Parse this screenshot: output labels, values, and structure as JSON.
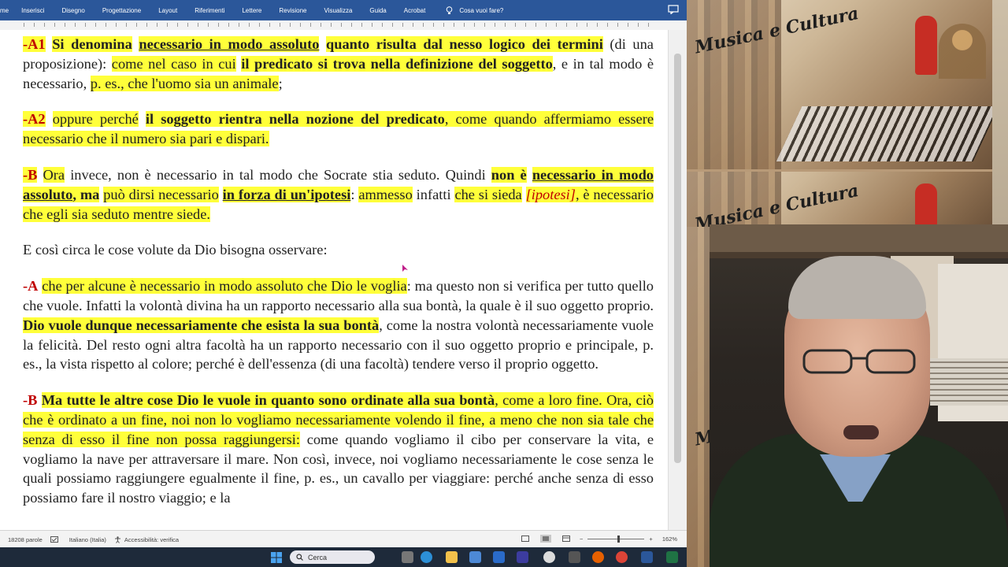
{
  "ribbon": {
    "tabs": [
      "me",
      "Inserisci",
      "Disegno",
      "Progettazione",
      "Layout",
      "Riferimenti",
      "Lettere",
      "Revisione",
      "Visualizza",
      "Guida",
      "Acrobat"
    ],
    "tell_me": "Cosa vuoi fare?"
  },
  "document": {
    "a1": {
      "label": "-A1",
      "t1": "Si denomina",
      "t2": "necessario in modo assoluto",
      "t3": "quanto risulta dal nesso logico dei termini",
      "t4": "(di una proposizione):",
      "t5": "come nel caso in cui",
      "t6": "il predicato si trova nella definizione del soggetto",
      "t7": ", e in tal modo è necessario,",
      "t8": "p. es., che l'uomo sia un animale",
      "t9": ";"
    },
    "a2": {
      "label": "-A2",
      "t1": "oppure perché",
      "t2": "il soggetto rientra nella nozione del predicato",
      "t3": ", come quando affermiamo essere necessario che il numero sia pari e dispari."
    },
    "b1": {
      "label": "-B",
      "t1": "Ora",
      "t2": "invece, non è necessario in tal modo che Socrate stia seduto. Quindi",
      "t3": "non è",
      "t4": "necessario in modo assoluto",
      "t5": ", ma",
      "t6": "può dirsi necessario",
      "t7": "in forza di un'ipotesi",
      "t8": ":",
      "t9": "ammesso",
      "t10": "infatti",
      "t11": "che si sieda",
      "t12": "[ipotesi]",
      "t13": ", è necessario che egli sia seduto mentre siede."
    },
    "p_intro": "E così circa le cose volute da Dio bisogna osservare:",
    "a3": {
      "label": "-A",
      "t1": "che per alcune è necessario in modo assoluto che Dio le voglia",
      "t2": ": ma questo non si verifica per tutto quello che vuole. Infatti la volontà divina ha un rapporto necessario alla sua bontà, la quale è il suo oggetto proprio.",
      "t3": "Dio vuole dunque necessariamente che esista la sua bontà",
      "t4": ", come la nostra volontà necessariamente vuole la felicità. Del resto ogni altra facoltà ha un rapporto necessario con il suo oggetto proprio e principale, p. es., la vista rispetto al colore; perché è dell'essenza (di una facoltà) tendere verso il proprio oggetto."
    },
    "b2": {
      "label": "-B",
      "t1": "Ma tutte le altre cose Dio le vuole in quanto sono ordinate alla sua bontà",
      "t2": ", come a loro fine. Ora, ciò che è ordinato a un fine, noi non lo vogliamo necessariamente volendo il fine, a meno che non sia tale che senza di esso il fine non possa raggiungersi:",
      "t3": "come quando vogliamo il cibo per conservare la vita, e vogliamo la nave per attraversare il mare. Non così, invece, noi vogliamo necessariamente le cose senza le quali possiamo raggiungere egualmente il fine, p. es., un cavallo per viaggiare: perché anche senza di esso possiamo fare il nostro viaggio; e la"
    }
  },
  "status": {
    "words": "18208 parole",
    "language": "Italiano (Italia)",
    "accessibility": "Accessibilità: verifica",
    "zoom": "162%",
    "zoom_minus": "−",
    "zoom_plus": "+"
  },
  "taskbar": {
    "search": "Cerca"
  },
  "overlay": {
    "brand": "Musica e Cultura",
    "brand2": "Musica e Cultura",
    "brand3": "M"
  },
  "colors": {
    "ribbon": "#2b579a",
    "highlight": "#ffff3a",
    "label_red": "#c00000"
  }
}
